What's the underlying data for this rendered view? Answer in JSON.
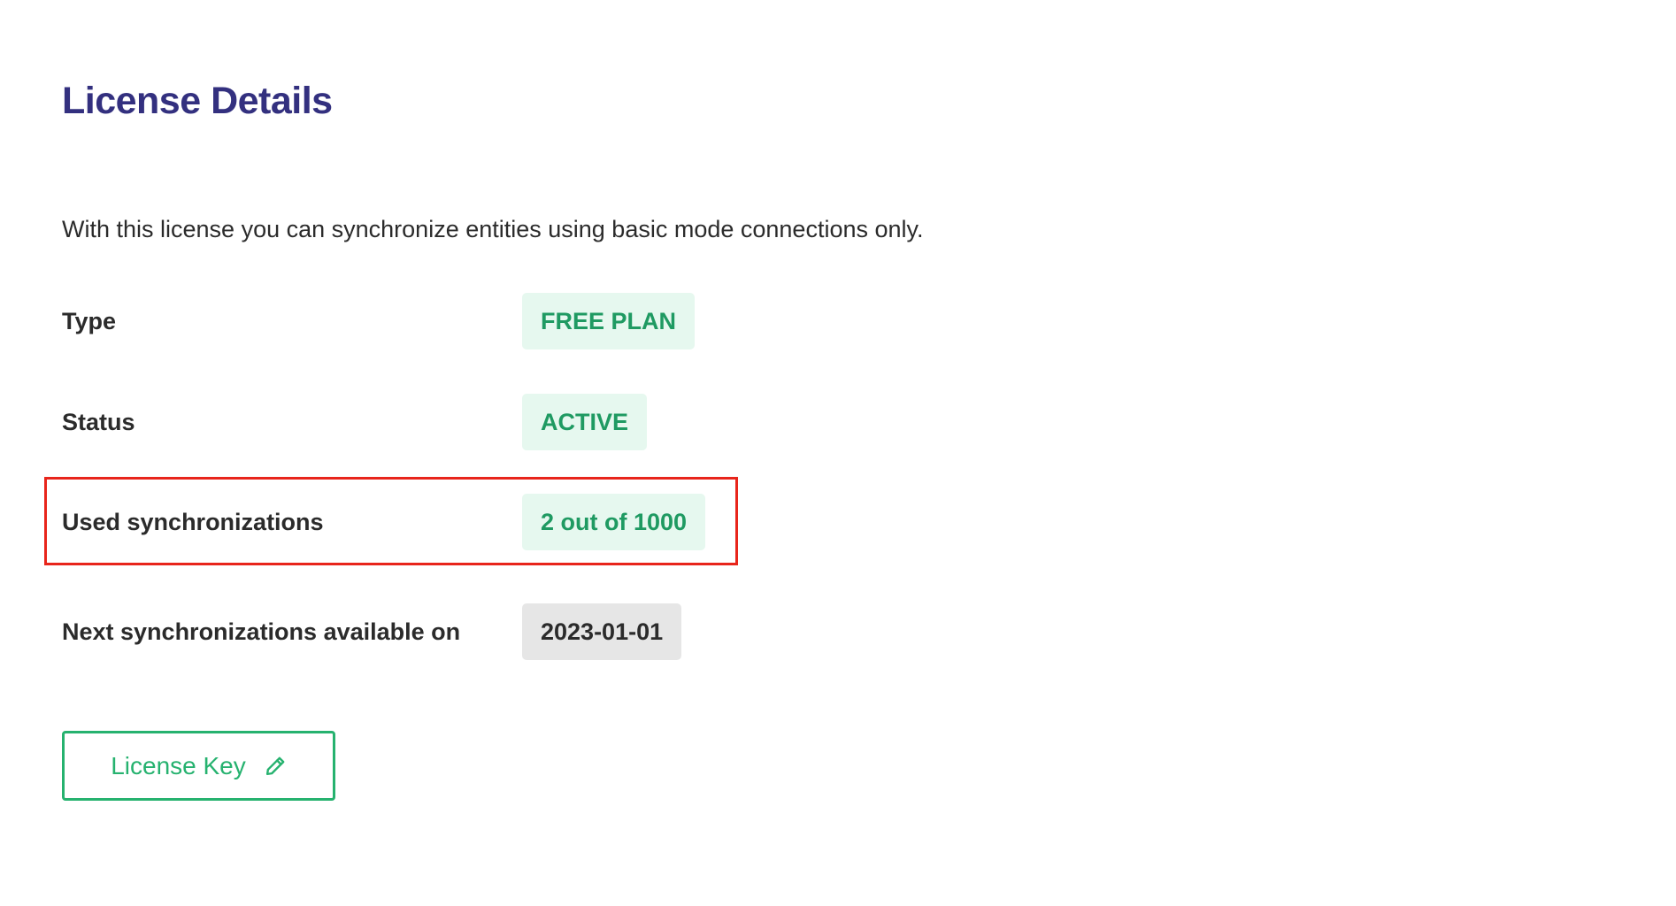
{
  "page": {
    "title": "License Details",
    "description": "With this license you can synchronize entities using basic mode connections only."
  },
  "details": {
    "type": {
      "label": "Type",
      "value": "FREE PLAN"
    },
    "status": {
      "label": "Status",
      "value": "ACTIVE"
    },
    "used_synchronizations": {
      "label": "Used synchronizations",
      "value": "2 out of 1000"
    },
    "next_synchronizations": {
      "label": "Next synchronizations available on",
      "value": "2023-01-01"
    }
  },
  "actions": {
    "license_key_label": "License Key",
    "license_key_icon": "pencil-icon"
  },
  "colors": {
    "title": "#33307f",
    "accent_green": "#26b26f",
    "badge_green_bg": "#e6f8ef",
    "badge_green_text": "#1f9a62",
    "badge_grey_bg": "#e6e6e6",
    "highlight_red": "#e8251b"
  }
}
